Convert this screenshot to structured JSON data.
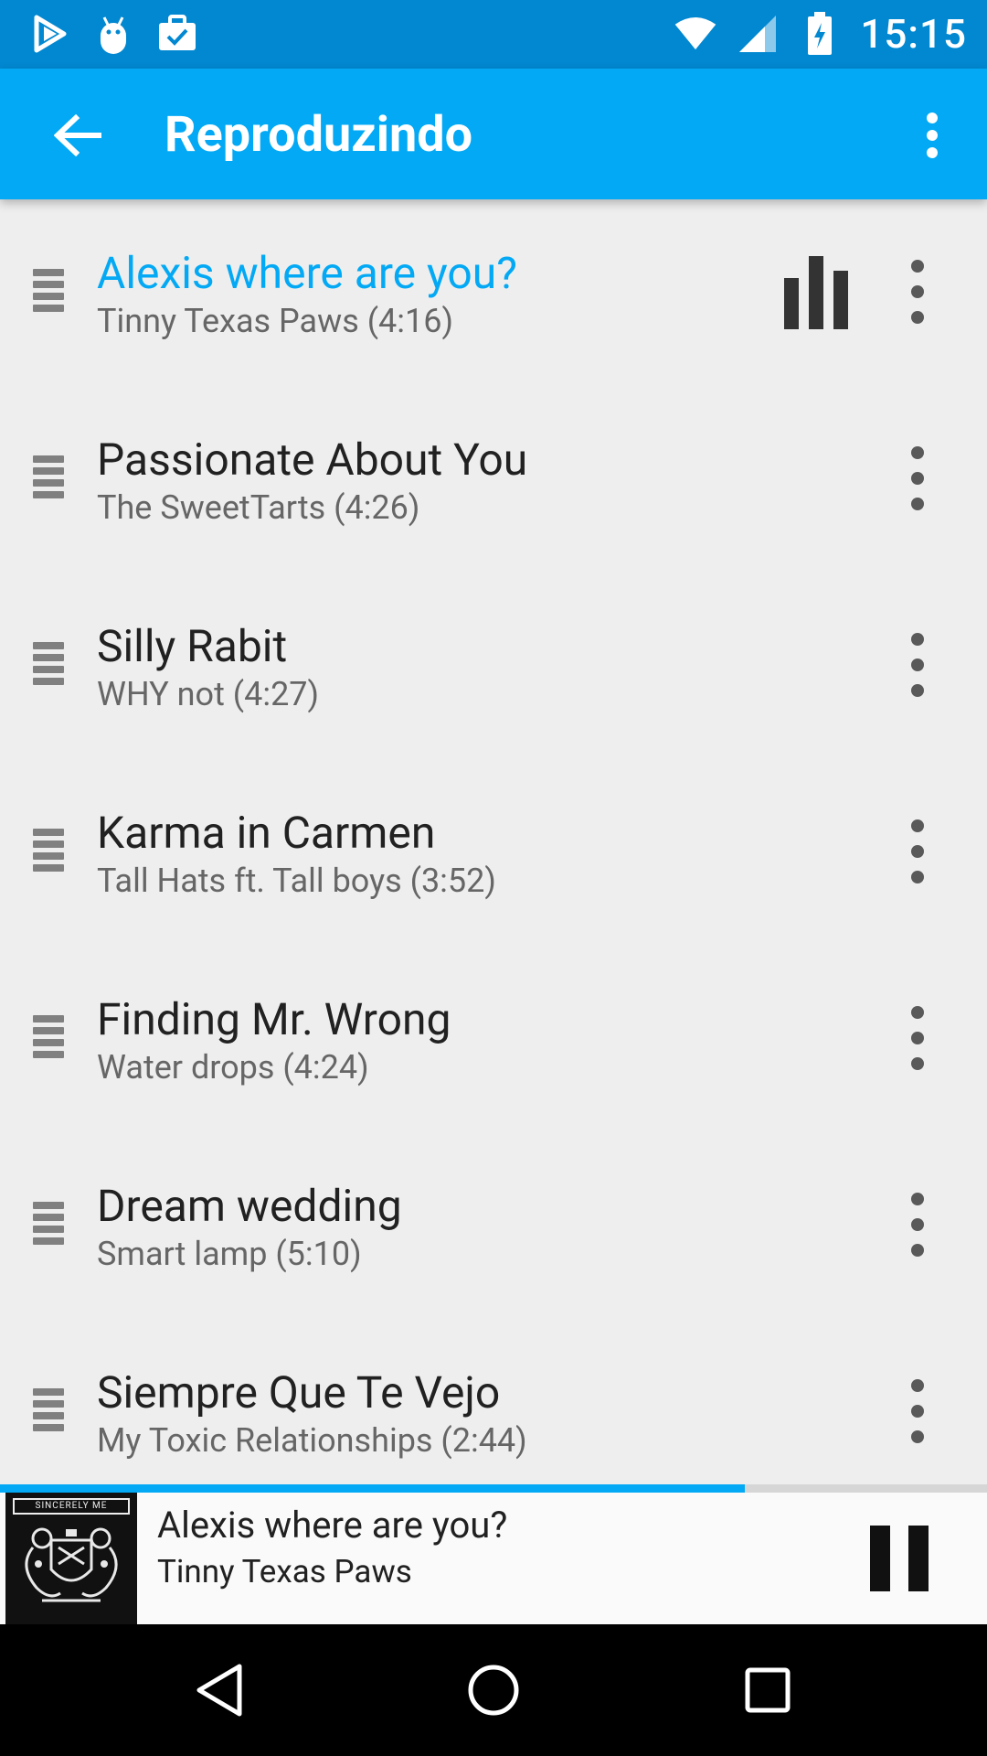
{
  "status_bar": {
    "time": "15:15",
    "left_icons": [
      "play-store-icon",
      "android-debug-icon",
      "briefcase-check-icon"
    ],
    "right_icons": [
      "wifi-icon",
      "cell-signal-icon",
      "battery-charging-icon"
    ]
  },
  "app_bar": {
    "title": "Reproduzindo",
    "back_icon": "arrow-back-icon",
    "menu_icon": "more-vert-icon"
  },
  "queue": [
    {
      "title": "Alexis where are you?",
      "subtitle": "Tinny Texas Paws (4:16)",
      "current": true
    },
    {
      "title": "Passionate About You",
      "subtitle": "The SweetTarts (4:26)",
      "current": false
    },
    {
      "title": "Silly Rabit",
      "subtitle": "WHY not (4:27)",
      "current": false
    },
    {
      "title": "Karma in Carmen",
      "subtitle": "Tall Hats ft. Tall boys (3:52)",
      "current": false
    },
    {
      "title": "Finding Mr. Wrong",
      "subtitle": "Water drops (4:24)",
      "current": false
    },
    {
      "title": "Dream wedding",
      "subtitle": "Smart lamp (5:10)",
      "current": false
    },
    {
      "title": "Siempre Que Te Vejo",
      "subtitle": "My Toxic Relationships (2:44)",
      "current": false
    }
  ],
  "progress": 0.755,
  "now_playing": {
    "title": "Alexis where are you?",
    "artist": "Tinny Texas Paws",
    "album_art_text": "SINCERELY ME",
    "state_icon": "pause-icon"
  },
  "nav_bar": {
    "icons": [
      "nav-back-icon",
      "nav-home-icon",
      "nav-recents-icon"
    ]
  },
  "colors": {
    "status_bar": "#0288d1",
    "app_bar": "#03a9f4",
    "accent": "#03a9f4",
    "background": "#eeeeee"
  }
}
